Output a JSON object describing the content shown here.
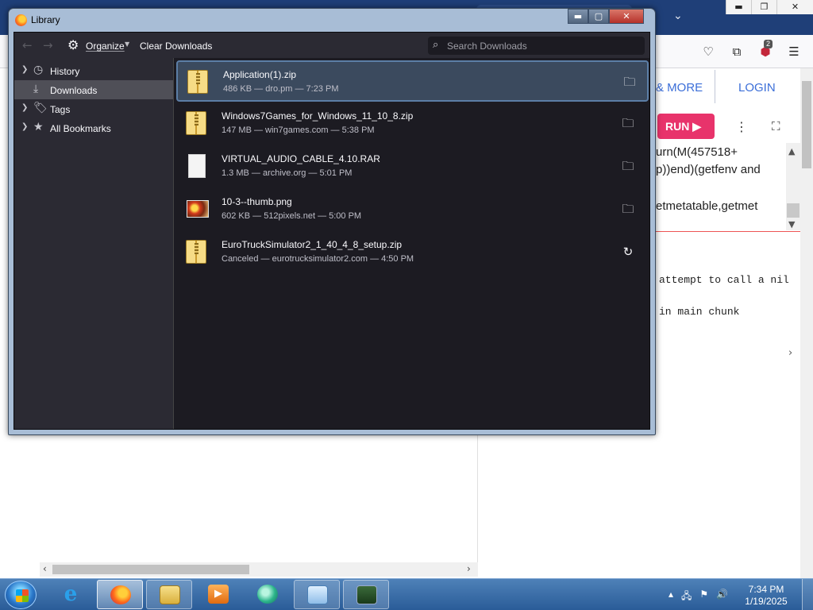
{
  "window": {
    "title": "Library",
    "controls": {
      "minimize": "▬",
      "maximize": "▢",
      "close": "✕"
    }
  },
  "toolbar": {
    "back_icon": "←",
    "forward_icon": "→",
    "organize_label": "Organize",
    "clear_label": "Clear Downloads",
    "search_placeholder": "Search Downloads"
  },
  "sidebar": {
    "items": [
      {
        "label": "History",
        "icon": "clock-icon",
        "expandable": true,
        "selected": false
      },
      {
        "label": "Downloads",
        "icon": "download-icon",
        "expandable": false,
        "selected": true
      },
      {
        "label": "Tags",
        "icon": "tags-icon",
        "expandable": true,
        "selected": false
      },
      {
        "label": "All Bookmarks",
        "icon": "star-icon",
        "expandable": true,
        "selected": false
      }
    ]
  },
  "downloads": [
    {
      "name": "Application(1).zip",
      "meta": "486 KB — dro.pm — 7:23 PM",
      "icon": "zip-file-icon",
      "action": "show-in-folder",
      "selected": true
    },
    {
      "name": "Windows7Games_for_Windows_11_10_8.zip",
      "meta": "147 MB — win7games.com — 5:38 PM",
      "icon": "zip-file-icon",
      "action": "show-in-folder",
      "selected": false
    },
    {
      "name": "VIRTUAL_AUDIO_CABLE_4.10.RAR",
      "meta": "1.3 MB — archive.org — 5:01 PM",
      "icon": "blank-file-icon",
      "action": "show-in-folder",
      "selected": false
    },
    {
      "name": "10-3--thumb.png",
      "meta": "602 KB — 512pixels.net — 5:00 PM",
      "icon": "image-file-icon",
      "action": "show-in-folder",
      "selected": false
    },
    {
      "name": "EuroTruckSimulator2_1_40_4_8_setup.zip",
      "meta": "Canceled — eurotrucksimulator2.com — 4:50 PM",
      "icon": "zip-file-icon",
      "action": "retry",
      "selected": false
    }
  ],
  "background_page": {
    "nav_more": "& MORE",
    "nav_login": "LOGIN",
    "run_label": "RUN ▶",
    "toolbar_badge": "2",
    "code_lines": [
      "urn(M(457518+",
      "p))end)(getfenv and",
      "etmetatable,getmet"
    ],
    "output_lines": [
      "attempt to call a nil",
      "in main chunk"
    ]
  },
  "taskbar": {
    "time": "7:34 PM",
    "date": "1/19/2025",
    "apps": [
      "internet-explorer",
      "firefox",
      "file-explorer",
      "media-player",
      "app-bird",
      "control-panel",
      "terminal-monitor"
    ]
  },
  "colors": {
    "library_bg": "#1c1b22",
    "library_panel": "#2b2a33",
    "selection": "#3b4a5e",
    "run_button": "#e8336b",
    "link_blue": "#3b6ed8",
    "taskbar": "#2a5c98"
  }
}
